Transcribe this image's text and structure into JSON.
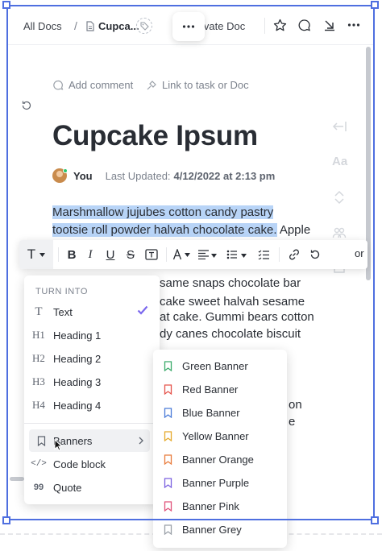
{
  "header": {
    "all_docs": "All Docs",
    "separator": "/",
    "doc_name": "Cupca...",
    "private_label": "ivate Doc",
    "icons": [
      "tag-icon",
      "more-horizontal-icon",
      "star-icon",
      "comment-icon",
      "collapse-icon",
      "more-icon"
    ]
  },
  "doc": {
    "add_comment": "Add comment",
    "link_task": "Link to task or Doc",
    "title": "Cupcake Ipsum",
    "author": "You",
    "last_updated_label": "Last Updated:",
    "last_updated_value": "4/12/2022 at 2:13 pm",
    "highlight_line1": "Marshmallow jujubes cotton candy pastry",
    "highlight_line2": "tootsie roll powder halvah chocolate cake.",
    "line2_rest": " Apple",
    "line4": "same snaps chocolate bar",
    "line5": "cake sweet halvah sesame",
    "line6": "at cake. Gummi bears cotton",
    "line7": "dy canes chocolate biscuit",
    "line_on": "on",
    "line_e": "e"
  },
  "toolbar": {
    "text_style": "T",
    "bold": "B",
    "italic": "I",
    "underline": "U",
    "strike": "S",
    "trailing_text": "or"
  },
  "turn_into": {
    "header": "TURN INTO",
    "items": [
      {
        "label": "Text",
        "icon": "T"
      },
      {
        "label": "Heading 1",
        "icon": "H1"
      },
      {
        "label": "Heading 2",
        "icon": "H2"
      },
      {
        "label": "Heading 3",
        "icon": "H3"
      },
      {
        "label": "Heading 4",
        "icon": "H4"
      },
      {
        "label": "Banners",
        "icon": "bookmark"
      },
      {
        "label": "Code block",
        "icon": "</>"
      },
      {
        "label": "Quote",
        "icon": "99"
      }
    ],
    "selected": "Text"
  },
  "banners": [
    {
      "label": "Green Banner",
      "color": "#3aaa6a"
    },
    {
      "label": "Red Banner",
      "color": "#e5534b"
    },
    {
      "label": "Blue Banner",
      "color": "#4a7bd8"
    },
    {
      "label": "Yellow Banner",
      "color": "#e5a92b"
    },
    {
      "label": "Banner Orange",
      "color": "#e87b3b"
    },
    {
      "label": "Banner Purple",
      "color": "#7b61e0"
    },
    {
      "label": "Banner Pink",
      "color": "#e0537b"
    },
    {
      "label": "Banner Grey",
      "color": "#9aa0a8"
    }
  ],
  "colors": {
    "accent": "#7b68ee",
    "selection_frame": "#4f6fe0",
    "text_highlight": "#b8d4f7"
  }
}
